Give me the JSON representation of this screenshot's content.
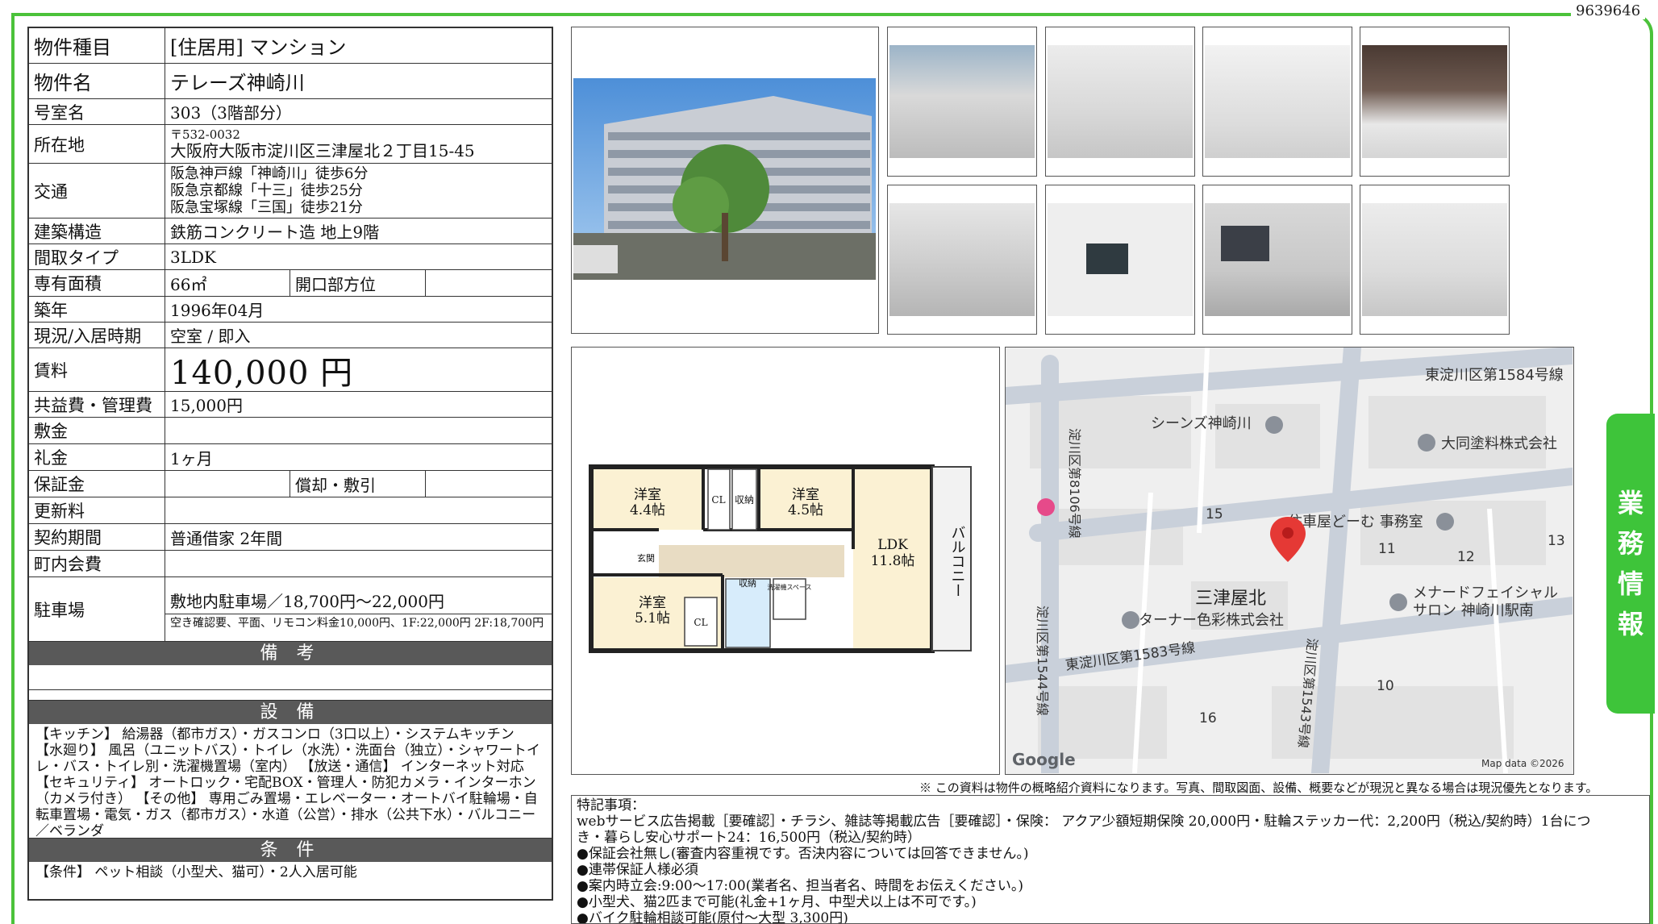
{
  "doc_id": "9639646",
  "side_tab": [
    "業",
    "務",
    "情",
    "報"
  ],
  "property": {
    "type_label": "物件種目",
    "type_value": "[住居用]  マンション",
    "name_label": "物件名",
    "name_value": "テレーズ神崎川",
    "room_label": "号室名",
    "room_value": "303（3階部分）",
    "address_label": "所在地",
    "postal": "〒532-0032",
    "address": "大阪府大阪市淀川区三津屋北２丁目15-45",
    "traffic_label": "交通",
    "traffic": [
      "阪急神戸線「神崎川」徒歩6分",
      "阪急京都線「十三」徒歩25分",
      "阪急宝塚線「三国」徒歩21分"
    ],
    "structure_label": "建築構造",
    "structure_value": "鉄筋コンクリート造 地上9階",
    "layout_label": "間取タイプ",
    "layout_value": "3LDK",
    "area_label": "専有面積",
    "area_value": "66㎡",
    "direction_label": "開口部方位",
    "direction_value": "",
    "built_label": "築年",
    "built_value": "1996年04月",
    "status_label": "現況/入居時期",
    "status_value": "空室 /  即入",
    "rent_label": "賃料",
    "rent_value": "140,000 円",
    "fee_label": "共益費・管理費",
    "fee_value": "15,000円",
    "deposit_label": "敷金",
    "deposit_value": "",
    "key_money_label": "礼金",
    "key_money_value": "1ヶ月",
    "guarantee_label": "保証金",
    "guarantee_value": "",
    "amort_label": "償却・敷引",
    "amort_value": "",
    "renewal_label": "更新料",
    "renewal_value": "",
    "contract_label": "契約期間",
    "contract_value": "普通借家 2年間",
    "community_label": "町内会費",
    "community_value": "",
    "parking_label": "駐車場",
    "parking_value": "敷地内駐車場／18,700円～22,000円",
    "parking_note": "空き確認要、平面、リモコン料金10,000円、1F:22,000円 2F:18,700円",
    "notes_header": "備 考",
    "notes_value": "",
    "equipment_header": "設 備",
    "equipment_text": "【キッチン】 給湯器（都市ガス）・ガスコンロ（3口以上）・システムキッチン 【水廻り】 風呂（ユニットバス）・トイレ（水洗）・洗面台（独立）・シャワートイレ・バス・トイレ別・洗濯機置場（室内） 【放送・通信】 インターネット対応 【セキュリティ】 オートロック・宅配BOX・管理人・防犯カメラ・インターホン（カメラ付き） 【その他】 専用ごみ置場・エレベーター・オートバイ駐輪場・自転車置場・電気・ガス（都市ガス）・水道（公営）・排水（公共下水）・バルコニー／ベランダ",
    "conditions_header": "条 件",
    "conditions_text": "【条件】 ペット相談（小型犬、猫可）・2人入居可能"
  },
  "floorplan": {
    "rooms": [
      {
        "name": "洋室",
        "size": "4.4帖"
      },
      {
        "name": "洋室",
        "size": "4.5帖"
      },
      {
        "name": "LDK",
        "size": "11.8帖"
      },
      {
        "name": "洋室",
        "size": "5.1帖"
      }
    ],
    "labels": {
      "cl": "CL",
      "storage": "収納",
      "balcony": "バルコニー",
      "washer": "洗濯機スペース",
      "entrance": "玄関"
    }
  },
  "map": {
    "roads": [
      "東淀川区第1584号線",
      "淀川区第8106号線",
      "東淀川区第1583号線",
      "淀川区第1544号線",
      "淀川区第1543号線"
    ],
    "pois": [
      "シーンズ神崎川",
      "大同塗料株式会社",
      "住車屋どーむ 事務室",
      "メナードフェイシャル",
      "サロン 神崎川駅南",
      "ターナー色彩株式会社"
    ],
    "area_name": "三津屋北",
    "block_numbers": [
      "15",
      "11",
      "12",
      "13",
      "10",
      "16"
    ],
    "google": "Google",
    "map_data": "Map data ©2026"
  },
  "disclaimer": "※ この資料は物件の概略紹介資料になります。写真、間取図面、設備、概要などが現況と異なる場合は現況優先となります。",
  "remarks": [
    "特記事項：",
    "webサービス広告掲載［要確認］・チラシ、雑誌等掲載広告［要確認］・保険： アクア少額短期保険 20,000円・駐輪ステッカー代：2,200円（税込/契約時）1台につ",
    "き・暮らし安心サポート24：16,500円（税込/契約時）",
    "●保証会社無し(審査内容重視です。否決内容については回答できません。)",
    "●連帯保証人様必須",
    "●案内時立会:9:00～17:00(業者名、担当者名、時間をお伝えください。)",
    "●小型犬、猫2匹まで可能(礼金+1ヶ月、中型犬以上は不可です。)",
    "●バイク駐輪相談可能(原付～大型  3,300円)"
  ]
}
